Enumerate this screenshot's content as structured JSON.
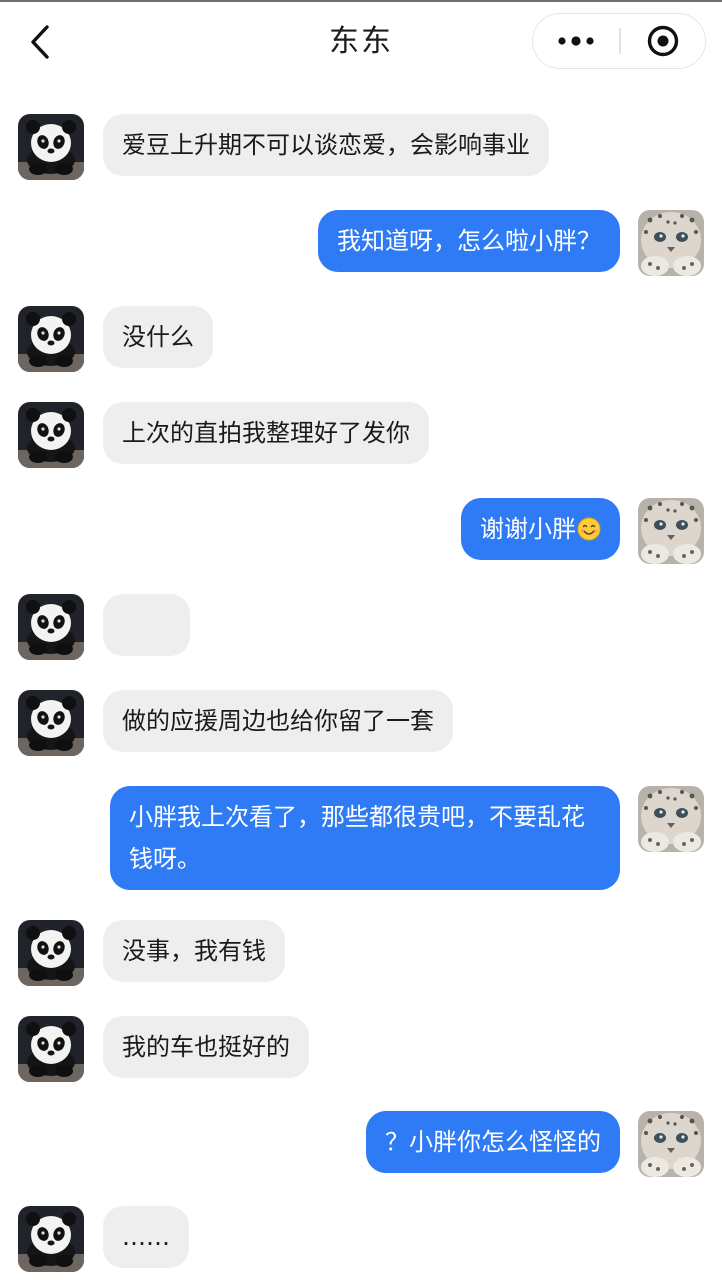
{
  "header": {
    "title": "东东",
    "back_icon": "chevron-left-icon",
    "more_icon": "more-dots-icon",
    "close_icon": "target-close-icon"
  },
  "colors": {
    "accent": "#2f7bf6",
    "bubble_left": "#eeeeee",
    "bubble_right_text": "#ffffff",
    "bubble_left_text": "#1a1a1a"
  },
  "avatars": {
    "contact": "panda-avatar",
    "self": "snow-leopard-avatar"
  },
  "messages": [
    {
      "side": "left",
      "text": "爱豆上升期不可以谈恋爱，会影响事业"
    },
    {
      "side": "right",
      "text": "我知道呀，怎么啦小胖？"
    },
    {
      "side": "left",
      "text": "没什么"
    },
    {
      "side": "left",
      "text": "上次的直拍我整理好了发你"
    },
    {
      "side": "right",
      "text": "谢谢小胖",
      "emoji": "smiling-face-emoji"
    },
    {
      "side": "left",
      "text": ""
    },
    {
      "side": "left",
      "text": "做的应援周边也给你留了一套"
    },
    {
      "side": "right",
      "text": "小胖我上次看了，那些都很贵吧，不要乱花钱呀。"
    },
    {
      "side": "left",
      "text": "没事，我有钱"
    },
    {
      "side": "left",
      "text": "我的车也挺好的"
    },
    {
      "side": "right",
      "text": "？小胖你怎么怪怪的"
    },
    {
      "side": "left",
      "text": "……"
    }
  ]
}
